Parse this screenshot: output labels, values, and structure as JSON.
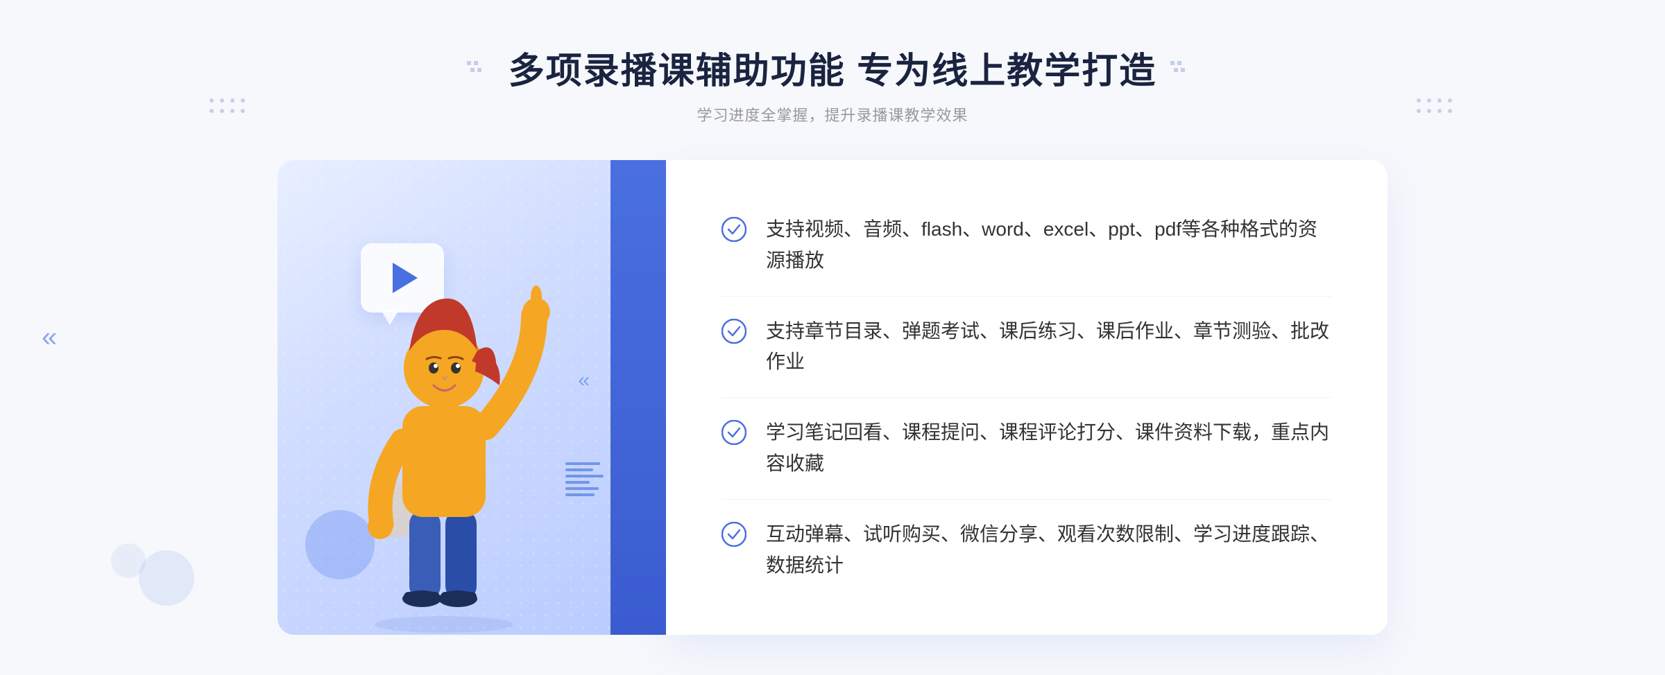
{
  "header": {
    "main_title": "多项录播课辅助功能 专为线上教学打造",
    "sub_title": "学习进度全掌握，提升录播课教学效果"
  },
  "features": [
    {
      "id": 1,
      "text": "支持视频、音频、flash、word、excel、ppt、pdf等各种格式的资源播放"
    },
    {
      "id": 2,
      "text": "支持章节目录、弹题考试、课后练习、课后作业、章节测验、批改作业"
    },
    {
      "id": 3,
      "text": "学习笔记回看、课程提问、课程评论打分、课件资料下载，重点内容收藏"
    },
    {
      "id": 4,
      "text": "互动弹幕、试听购买、微信分享、观看次数限制、学习进度跟踪、数据统计"
    }
  ],
  "colors": {
    "primary_blue": "#4a6fe0",
    "light_blue": "#e8efff",
    "text_dark": "#1a2440",
    "text_gray": "#999999",
    "text_content": "#333333",
    "check_blue": "#4a6fe0"
  },
  "icons": {
    "check": "circle-check",
    "play": "play-triangle",
    "arrow_left": "double-chevron-left",
    "arrow_right": "double-chevron-right"
  }
}
